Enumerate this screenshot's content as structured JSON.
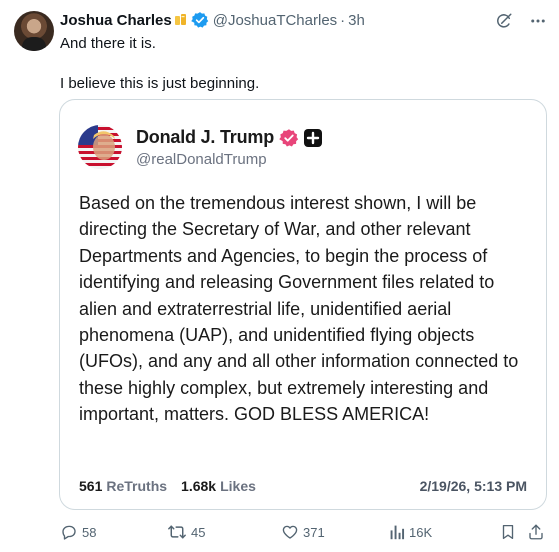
{
  "tweet": {
    "author": {
      "display_name": "Joshua Charles",
      "handle": "@JoshuaTCharles",
      "time": "3h",
      "separator": "·"
    },
    "text_line1": "And there it is.",
    "text_line2": "I believe this is just beginning."
  },
  "embedded_post": {
    "display_name": "Donald J. Trump",
    "handle": "@realDonaldTrump",
    "body": "Based on the tremendous interest shown, I will be directing the Secretary of War, and other relevant Departments and Agencies, to begin the process of identifying and releasing Government files related to alien and extraterrestrial life, unidentified aerial phenomena (UAP), and unidentified flying objects (UFOs), and any and all other information connected to these highly complex, but extremely interesting and important, matters. GOD BLESS AMERICA!",
    "retruths_count": "561",
    "retruths_label": "ReTruths",
    "likes_count": "1.68k",
    "likes_label": "Likes",
    "date": "2/19/26, 5:13 PM"
  },
  "actions": {
    "replies": "58",
    "reposts": "45",
    "likes": "371",
    "views": "16K"
  },
  "colors": {
    "verified_blue": "#1d9bf0",
    "truth_verified": "#e8457a",
    "muted_text": "#536471",
    "border": "#cfd9de"
  },
  "icons": [
    "gold-badge-icon",
    "verified-icon",
    "grok-icon",
    "more-icon",
    "reply-icon",
    "repost-icon",
    "like-icon",
    "views-icon",
    "bookmark-icon",
    "share-icon"
  ]
}
